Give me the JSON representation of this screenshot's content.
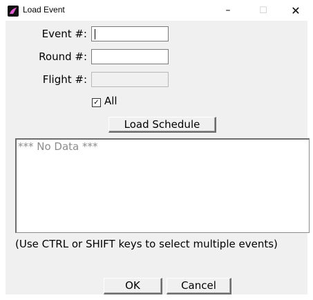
{
  "window": {
    "title": "Load Event",
    "controls": {
      "minimize": "–",
      "maximize": "☐",
      "close": "✕"
    }
  },
  "form": {
    "event_label": "Event #:",
    "event_value": "",
    "round_label": "Round #:",
    "round_value": "",
    "flight_label": "Flight #:",
    "flight_value": "",
    "all_checked": true,
    "all_check_glyph": "✓",
    "all_label": "All",
    "load_schedule_label": "Load Schedule"
  },
  "list": {
    "items": [
      "*** No Data ***"
    ]
  },
  "hint": "(Use CTRL or SHIFT keys to select multiple events)",
  "buttons": {
    "ok": "OK",
    "cancel": "Cancel"
  },
  "colors": {
    "client_bg": "#f0f0f0",
    "placeholder_text": "#8c8c8c"
  }
}
